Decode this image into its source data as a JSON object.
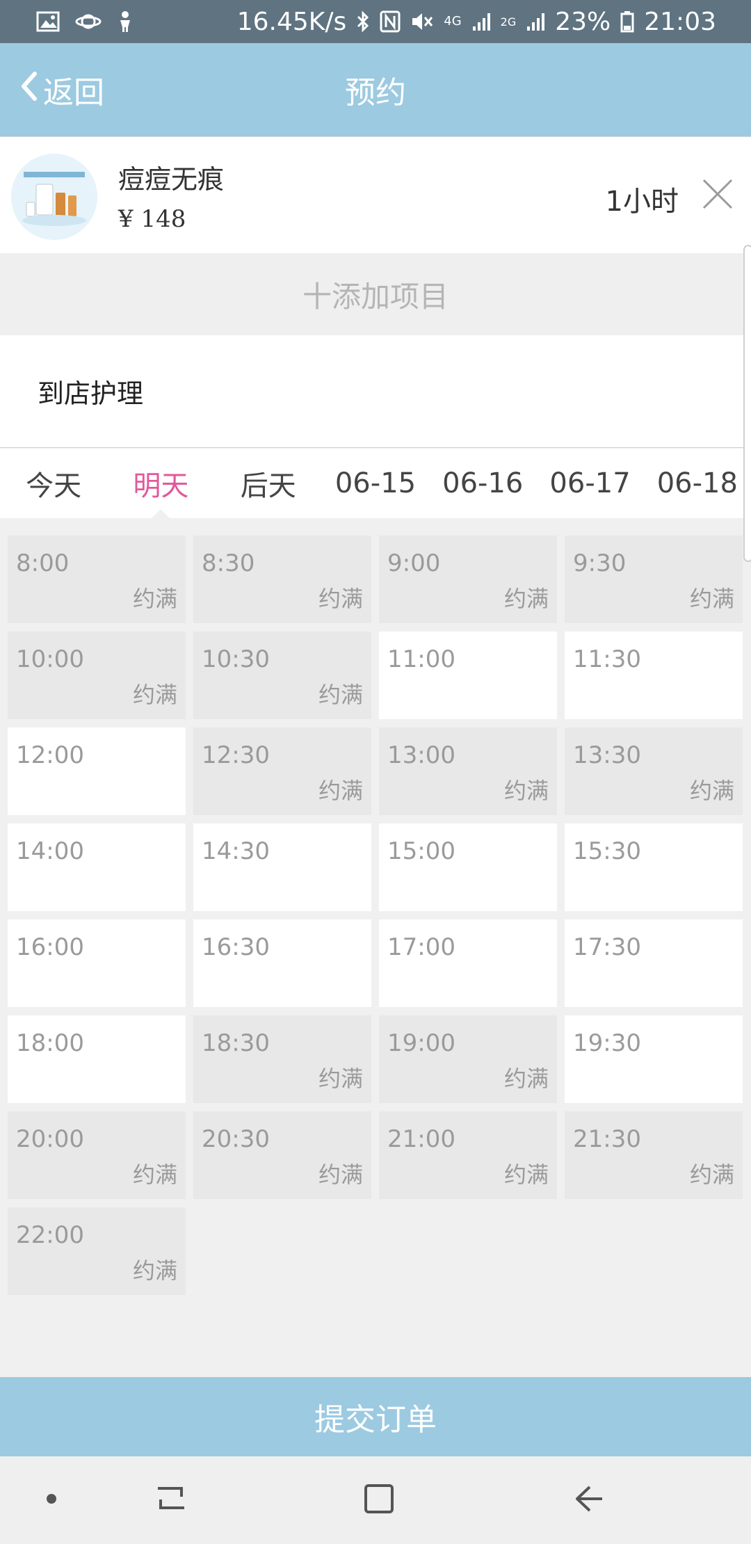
{
  "status_bar": {
    "network_speed": "16.45K/s",
    "network_type": "4G",
    "network_type2": "2G",
    "battery": "23%",
    "time": "21:03"
  },
  "header": {
    "back_label": "返回",
    "title": "预约"
  },
  "item": {
    "name": "痘痘无痕",
    "price": "¥ 148",
    "duration": "1小时"
  },
  "add_project_label": "十添加项目",
  "service_type": "到店护理",
  "date_tabs": [
    "今天",
    "明天",
    "后天",
    "06-15",
    "06-16",
    "06-17",
    "06-18"
  ],
  "active_date_tab": "明天",
  "slots": [
    {
      "time": "8:00",
      "status": "约满"
    },
    {
      "time": "8:30",
      "status": "约满"
    },
    {
      "time": "9:00",
      "status": "约满"
    },
    {
      "time": "9:30",
      "status": "约满"
    },
    {
      "time": "10:00",
      "status": "约满"
    },
    {
      "time": "10:30",
      "status": "约满"
    },
    {
      "time": "11:00",
      "status": ""
    },
    {
      "time": "11:30",
      "status": ""
    },
    {
      "time": "12:00",
      "status": ""
    },
    {
      "time": "12:30",
      "status": "约满"
    },
    {
      "time": "13:00",
      "status": "约满"
    },
    {
      "time": "13:30",
      "status": "约满"
    },
    {
      "time": "14:00",
      "status": ""
    },
    {
      "time": "14:30",
      "status": ""
    },
    {
      "time": "15:00",
      "status": ""
    },
    {
      "time": "15:30",
      "status": ""
    },
    {
      "time": "16:00",
      "status": ""
    },
    {
      "time": "16:30",
      "status": ""
    },
    {
      "time": "17:00",
      "status": ""
    },
    {
      "time": "17:30",
      "status": ""
    },
    {
      "time": "18:00",
      "status": ""
    },
    {
      "time": "18:30",
      "status": "约满"
    },
    {
      "time": "19:00",
      "status": "约满"
    },
    {
      "time": "19:30",
      "status": ""
    },
    {
      "time": "20:00",
      "status": "约满"
    },
    {
      "time": "20:30",
      "status": "约满"
    },
    {
      "time": "21:00",
      "status": "约满"
    },
    {
      "time": "21:30",
      "status": "约满"
    },
    {
      "time": "22:00",
      "status": "约满"
    }
  ],
  "submit_label": "提交订单",
  "colors": {
    "header_bg": "#9ccae1",
    "status_bar_bg": "#5f7381",
    "active_tab": "#e2589b",
    "slot_full_bg": "#e8e8e8",
    "slot_open_bg": "#ffffff"
  },
  "icons": {
    "status_left": [
      "image-icon",
      "planet-icon",
      "person-icon"
    ],
    "status_right": [
      "bluetooth-icon",
      "nfc-icon",
      "mute-icon",
      "signal-icon",
      "battery-icon"
    ],
    "nav": [
      "dot-icon",
      "recent-apps-icon",
      "home-icon",
      "back-icon"
    ]
  }
}
